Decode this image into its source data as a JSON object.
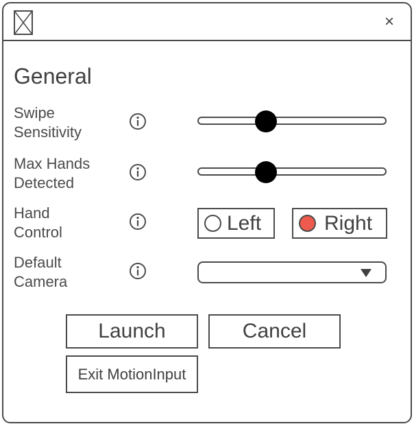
{
  "window": {
    "close_glyph": "×",
    "app_icon": "image-placeholder-icon"
  },
  "section": {
    "title": "General"
  },
  "settings": {
    "swipe_sensitivity": {
      "label_line1": "Swipe",
      "label_line2": "Sensitivity",
      "icon": "info-icon",
      "value_fraction": 0.36
    },
    "max_hands": {
      "label_line1": "Max Hands",
      "label_line2": "Detected",
      "icon": "info-icon",
      "value_fraction": 0.36
    },
    "hand_control": {
      "label_line1": "Hand",
      "label_line2": "Control",
      "icon": "info-icon",
      "options": [
        "Left",
        "Right"
      ],
      "selected": "Right"
    },
    "default_camera": {
      "label_line1": "Default",
      "label_line2": "Camera",
      "icon": "info-icon",
      "selected_value": ""
    }
  },
  "buttons": {
    "launch": "Launch",
    "cancel": "Cancel",
    "exit": "Exit MotionInput"
  },
  "colors": {
    "border": "#4a4a4a",
    "text": "#404040",
    "radio_selected": "#ee5a4d",
    "slider_thumb": "#000000"
  }
}
